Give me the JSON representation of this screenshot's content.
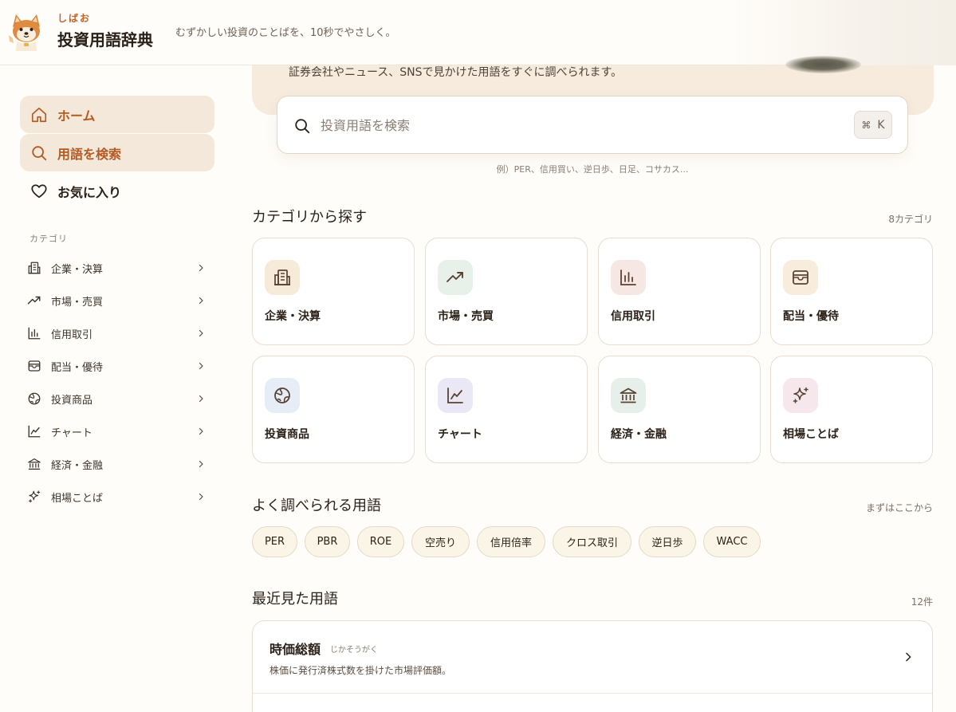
{
  "header": {
    "brand_small": "しばお",
    "brand_title": "投資用語辞典",
    "tagline": "むずかしい投資のことばを、10秒でやさしく。"
  },
  "hero": {
    "subtitle": "証券会社やニュース、SNSで見かけた用語をすぐに調べられます。"
  },
  "search": {
    "placeholder": "投資用語を検索",
    "shortcut_symbol": "⌘",
    "shortcut_key": "K",
    "hint": "例）PER、信用買い、逆日歩、日足、コサカス..."
  },
  "sidebar": {
    "nav": [
      {
        "label": "ホーム",
        "icon": "home-icon"
      },
      {
        "label": "用語を検索",
        "icon": "search-icon"
      },
      {
        "label": "お気に入り",
        "icon": "heart-icon"
      }
    ],
    "category_heading": "カテゴリ",
    "categories": [
      {
        "label": "企業・決算",
        "icon": "building-icon"
      },
      {
        "label": "市場・売買",
        "icon": "trend-up-icon"
      },
      {
        "label": "信用取引",
        "icon": "bar-chart-icon"
      },
      {
        "label": "配当・優待",
        "icon": "wallet-icon"
      },
      {
        "label": "投資商品",
        "icon": "globe-icon"
      },
      {
        "label": "チャート",
        "icon": "line-chart-icon"
      },
      {
        "label": "経済・金融",
        "icon": "bank-icon"
      },
      {
        "label": "相場ことば",
        "icon": "sparkles-icon"
      }
    ]
  },
  "categories_section": {
    "title": "カテゴリから探す",
    "meta": "8カテゴリ",
    "cards": [
      {
        "label": "企業・決算",
        "icon": "building-icon",
        "tile_color": "#f6ead9"
      },
      {
        "label": "市場・売買",
        "icon": "trend-up-icon",
        "tile_color": "#e7f1ea"
      },
      {
        "label": "信用取引",
        "icon": "bar-chart-icon",
        "tile_color": "#f6e6e4"
      },
      {
        "label": "配当・優待",
        "icon": "wallet-icon",
        "tile_color": "#f8eddc"
      },
      {
        "label": "投資商品",
        "icon": "globe-icon",
        "tile_color": "#e6edf6"
      },
      {
        "label": "チャート",
        "icon": "line-chart-icon",
        "tile_color": "#ebe8f5"
      },
      {
        "label": "経済・金融",
        "icon": "bank-icon",
        "tile_color": "#e7efea"
      },
      {
        "label": "相場ことば",
        "icon": "sparkles-icon",
        "tile_color": "#f5e7eb"
      }
    ]
  },
  "popular_section": {
    "title": "よく調べられる用語",
    "meta": "まずはここから",
    "terms": [
      "PER",
      "PBR",
      "ROE",
      "空売り",
      "信用倍率",
      "クロス取引",
      "逆日歩",
      "WACC"
    ]
  },
  "recent_section": {
    "title": "最近見た用語",
    "meta": "12件",
    "items": [
      {
        "term": "時価総額",
        "reading": "じかそうがく",
        "description": "株価に発行済株式数を掛けた市場評価額。"
      }
    ]
  },
  "colors": {
    "accent": "#b55a22",
    "icon_stroke": "#5a4232",
    "background": "#fffdf9"
  }
}
